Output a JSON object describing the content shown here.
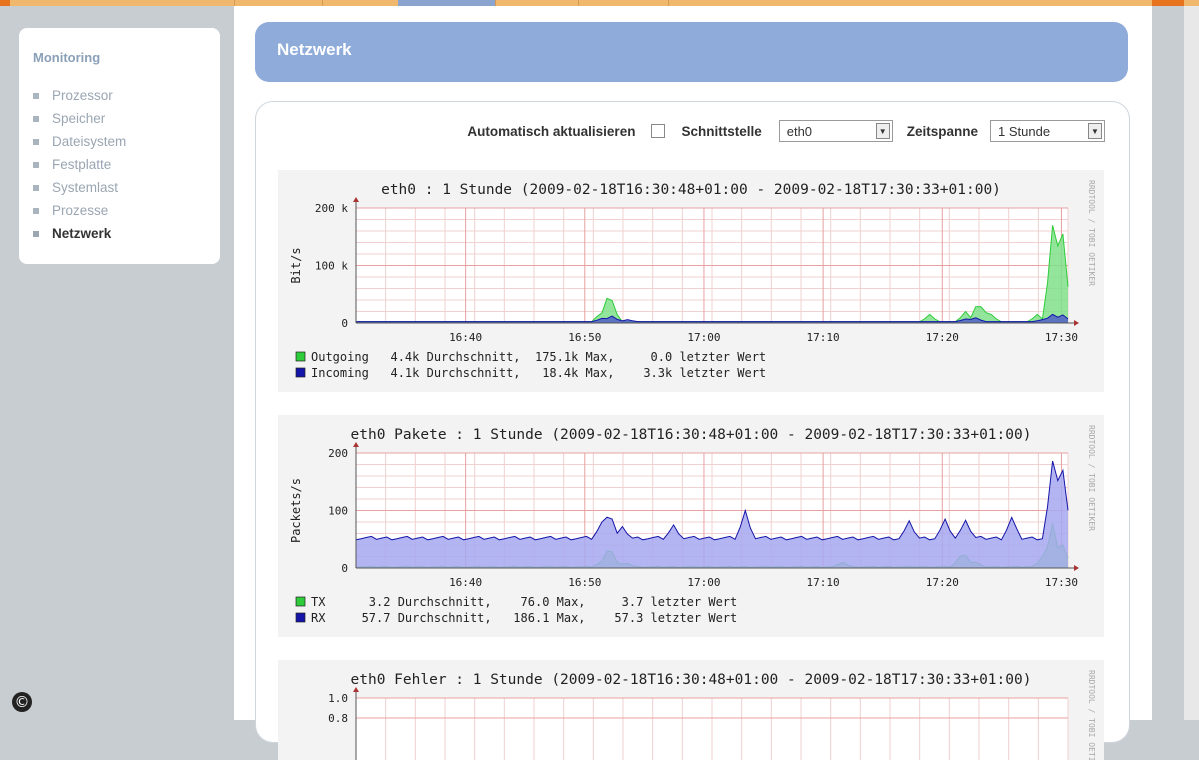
{
  "sidebar": {
    "title": "Monitoring",
    "items": [
      {
        "label": "Prozessor",
        "active": false
      },
      {
        "label": "Speicher",
        "active": false
      },
      {
        "label": "Dateisystem",
        "active": false
      },
      {
        "label": "Festplatte",
        "active": false
      },
      {
        "label": "Systemlast",
        "active": false
      },
      {
        "label": "Prozesse",
        "active": false
      },
      {
        "label": "Netzwerk",
        "active": true
      }
    ]
  },
  "page": {
    "title": "Netzwerk"
  },
  "controls": {
    "auto_refresh_label": "Automatisch aktualisieren",
    "auto_refresh_checked": false,
    "interface_label": "Schnittstelle",
    "interface_value": "eth0",
    "timespan_label": "Zeitspanne",
    "timespan_value": "1 Stunde"
  },
  "copyright_symbol": "©",
  "chart_data": [
    {
      "type": "area",
      "title": "eth0 : 1 Stunde (2009-02-18T16:30:48+01:00 - 2009-02-18T17:30:33+01:00)",
      "ylabel": "Bit/s",
      "ylim": [
        0,
        200000
      ],
      "yticks": [
        {
          "value": 0,
          "label": "0"
        },
        {
          "value": 100000,
          "label": "100 k"
        },
        {
          "value": 200000,
          "label": "200 k"
        }
      ],
      "xlim": [
        "16:31",
        "17:30"
      ],
      "xticks": [
        "16:40",
        "16:50",
        "17:00",
        "17:10",
        "17:20",
        "17:30"
      ],
      "watermark": "RRDTOOL / TOBI OETIKER",
      "series": [
        {
          "name": "Outgoing",
          "color": "#2ecc3a",
          "fill": "#7fe08a",
          "values": [
            2000,
            2000,
            2000,
            2000,
            2000,
            2000,
            2000,
            2000,
            2000,
            2000,
            2000,
            2000,
            2000,
            2000,
            2000,
            2000,
            2000,
            2000,
            2000,
            2000,
            2000,
            2000,
            2000,
            2000,
            2000,
            2000,
            2000,
            2000,
            2000,
            2000,
            2000,
            2000,
            2000,
            2000,
            2000,
            2000,
            2000,
            2000,
            2000,
            2000,
            2000,
            2000,
            2000,
            2000,
            2000,
            2000,
            2000,
            2000,
            2000,
            2000,
            2000,
            2000,
            2000,
            2000,
            2000,
            2000,
            2000,
            2000,
            2000,
            2000,
            2000,
            2000,
            2000,
            2000,
            2000,
            2000,
            2000,
            2000,
            2000,
            2000,
            2000,
            2000,
            2000,
            2000,
            2000,
            2000,
            2000,
            2000,
            2000,
            2000,
            2000,
            2000,
            2000,
            2000,
            2000,
            2000,
            2000,
            2000,
            2000,
            2000,
            2000,
            2000,
            2000,
            2000,
            2000,
            2000,
            2000,
            2000,
            2000,
            2000,
            2000,
            2000,
            2000,
            2000,
            2000,
            2000,
            2000,
            2000,
            2000,
            2000,
            2000,
            2000,
            2000,
            2000,
            2000,
            2000,
            2000,
            2000,
            2000,
            2000
          ],
          "peaks": [
            [
              47.5,
              15000
            ],
            [
              48.5,
              20000
            ],
            [
              49.5,
              55000
            ],
            [
              50.5,
              20000
            ],
            [
              112,
              15000
            ],
            [
              119,
              20000
            ],
            [
              121.5,
              40000
            ],
            [
              122.5,
              25000
            ],
            [
              124,
              15000
            ],
            [
              133,
              15000
            ],
            [
              136,
              170000
            ],
            [
              137,
              120000
            ],
            [
              138,
              155000
            ],
            [
              139,
              40000
            ]
          ],
          "stats": {
            "avg": "4.4k",
            "max": "175.1k",
            "last": "0.0"
          }
        },
        {
          "name": "Incoming",
          "color": "#1414a8",
          "fill": "#5060c8",
          "values": [
            2500,
            2500,
            2500,
            2500,
            2500,
            2500,
            2500,
            2500,
            2500,
            2500,
            2500,
            2500,
            2500,
            2500,
            2500,
            2500,
            2500,
            2500,
            2500,
            2500,
            2500,
            2500,
            2500,
            2500,
            2500,
            2500,
            2500,
            2500,
            2500,
            2500,
            2500,
            2500,
            2500,
            2500,
            2500,
            2500,
            2500,
            2500,
            2500,
            2500,
            2500,
            2500,
            2500,
            2500,
            2500,
            2500,
            2500,
            2500,
            2500,
            2500,
            2500,
            2500,
            2500,
            2500,
            2500,
            2500,
            2500,
            2500,
            2500,
            2500,
            2500,
            2500,
            2500,
            2500,
            2500,
            2500,
            2500,
            2500,
            2500,
            2500,
            2500,
            2500,
            2500,
            2500,
            2500,
            2500,
            2500,
            2500,
            2500,
            2500,
            2500,
            2500,
            2500,
            2500,
            2500,
            2500,
            2500,
            2500,
            2500,
            2500,
            2500,
            2500,
            2500,
            2500,
            2500,
            2500,
            2500,
            2500,
            2500,
            2500,
            2500,
            2500,
            2500,
            2500,
            2500,
            2500,
            2500,
            2500,
            2500,
            2500,
            2500,
            2500,
            2500,
            2500,
            2500,
            2500,
            2500,
            2500,
            2500,
            2500
          ],
          "peaks": [
            [
              48,
              8000
            ],
            [
              50,
              12000
            ],
            [
              53,
              6000
            ],
            [
              119,
              7000
            ],
            [
              121,
              9000
            ],
            [
              134,
              6000
            ],
            [
              136,
              15000
            ],
            [
              138,
              14000
            ]
          ],
          "stats": {
            "avg": "4.1k",
            "max": "18.4k",
            "last": "3.3k"
          }
        }
      ],
      "legend_suffix": {
        "avg": "Durchschnitt,",
        "max": "Max,",
        "last": "letzter Wert"
      }
    },
    {
      "type": "area",
      "title": "eth0 Pakete : 1 Stunde (2009-02-18T16:30:48+01:00 - 2009-02-18T17:30:33+01:00)",
      "ylabel": "Packets/s",
      "ylim": [
        0,
        200
      ],
      "yticks": [
        {
          "value": 0,
          "label": "0"
        },
        {
          "value": 100,
          "label": "100"
        },
        {
          "value": 200,
          "label": "200"
        }
      ],
      "xlim": [
        "16:31",
        "17:30"
      ],
      "xticks": [
        "16:40",
        "16:50",
        "17:00",
        "17:10",
        "17:20",
        "17:30"
      ],
      "watermark": "RRDTOOL / TOBI OETIKER",
      "series": [
        {
          "name": "TX",
          "color": "#2ecc3a",
          "fill": "#7fe08a",
          "base": 2,
          "peaks": [
            [
              48,
              12
            ],
            [
              49.5,
              40
            ],
            [
              51,
              10
            ],
            [
              53,
              8
            ],
            [
              95,
              10
            ],
            [
              118,
              20
            ],
            [
              119,
              22
            ],
            [
              121,
              10
            ],
            [
              134,
              20
            ],
            [
              136,
              78
            ],
            [
              138,
              40
            ]
          ],
          "stats": {
            "avg": "3.2",
            "max": "76.0",
            "last": "3.7"
          }
        },
        {
          "name": "RX",
          "color": "#1414a8",
          "fill": "#a6a8f0",
          "base": 52,
          "peaks": [
            [
              28,
              42
            ],
            [
              48,
              80
            ],
            [
              49.5,
              100
            ],
            [
              52,
              72
            ],
            [
              62,
              75
            ],
            [
              76,
              100
            ],
            [
              108,
              82
            ],
            [
              115,
              85
            ],
            [
              119,
              83
            ],
            [
              128,
              88
            ],
            [
              136,
              186
            ],
            [
              137,
              140
            ],
            [
              138,
              170
            ],
            [
              139,
              60
            ]
          ],
          "stats": {
            "avg": "57.7",
            "max": "186.1",
            "last": "57.3"
          }
        }
      ],
      "legend_suffix": {
        "avg": "Durchschnitt,",
        "max": "Max,",
        "last": "letzter Wert"
      }
    },
    {
      "type": "area",
      "title": "eth0 Fehler : 1 Stunde (2009-02-18T16:30:48+01:00 - 2009-02-18T17:30:33+01:00)",
      "ylim": [
        0,
        1.0
      ],
      "yticks": [
        {
          "value": 1.0,
          "label": "1.0"
        },
        {
          "value": 0.8,
          "label": "0.8"
        }
      ],
      "watermark": "RRDTOOL / TOBI OETIKER"
    }
  ]
}
